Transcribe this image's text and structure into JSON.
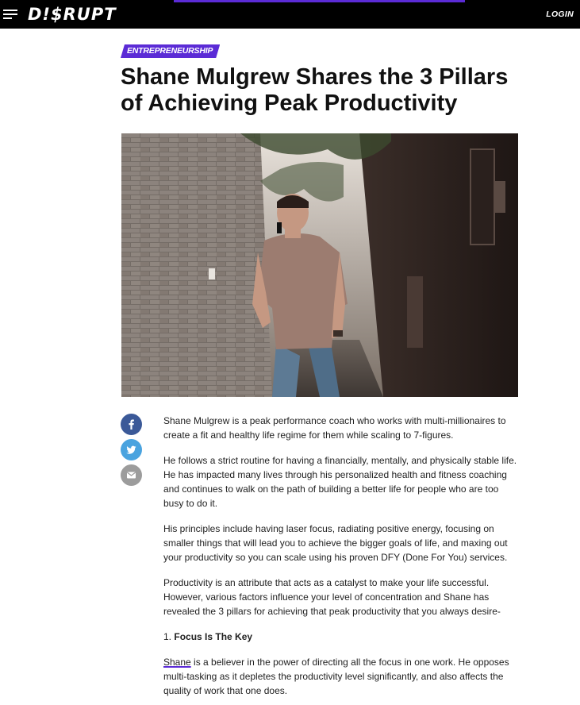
{
  "header": {
    "logo": "D!$RUPT",
    "login_label": "LOGIN",
    "reading_progress": 0.5
  },
  "article": {
    "category": "ENTREPRENEURSHIP",
    "title": "Shane Mulgrew Shares the 3 Pillars of Achieving Peak Productivity",
    "paragraphs": [
      "Shane Mulgrew is a peak performance coach who works with multi-millionaires to create a fit and healthy life regime for them while scaling to 7-figures.",
      "He follows a strict routine for having a financially, mentally, and physically stable life. He has impacted many lives through his personalized health and fitness coaching and continues to walk on the path of building a better life for people who are too busy to do it.",
      "His principles include having laser focus, radiating positive energy, focusing on smaller things that will lead you to achieve the bigger goals of life, and maxing out your productivity so you can scale using his proven DFY (Done For You) services.",
      "Productivity is an attribute that acts as a catalyst to make your life successful. However, various factors influence your level of concentration and Shane has revealed the 3 pillars for achieving that peak productivity that you always desire-"
    ],
    "heading_1_number": "1.",
    "heading_1_text": "Focus Is The Key",
    "p5_link": "Shane",
    "p5_rest": " is a believer in the power of directing all the focus in one work. He opposes multi-tasking as it depletes the productivity level significantly, and also affects the quality of work that one does."
  },
  "share": {
    "icons": [
      "facebook-icon",
      "twitter-icon",
      "email-icon"
    ]
  },
  "colors": {
    "accent": "#5b2bd6",
    "facebook": "#3b5998",
    "twitter": "#4aa3df",
    "email": "#9c9c9c",
    "header_bg": "#000000"
  }
}
